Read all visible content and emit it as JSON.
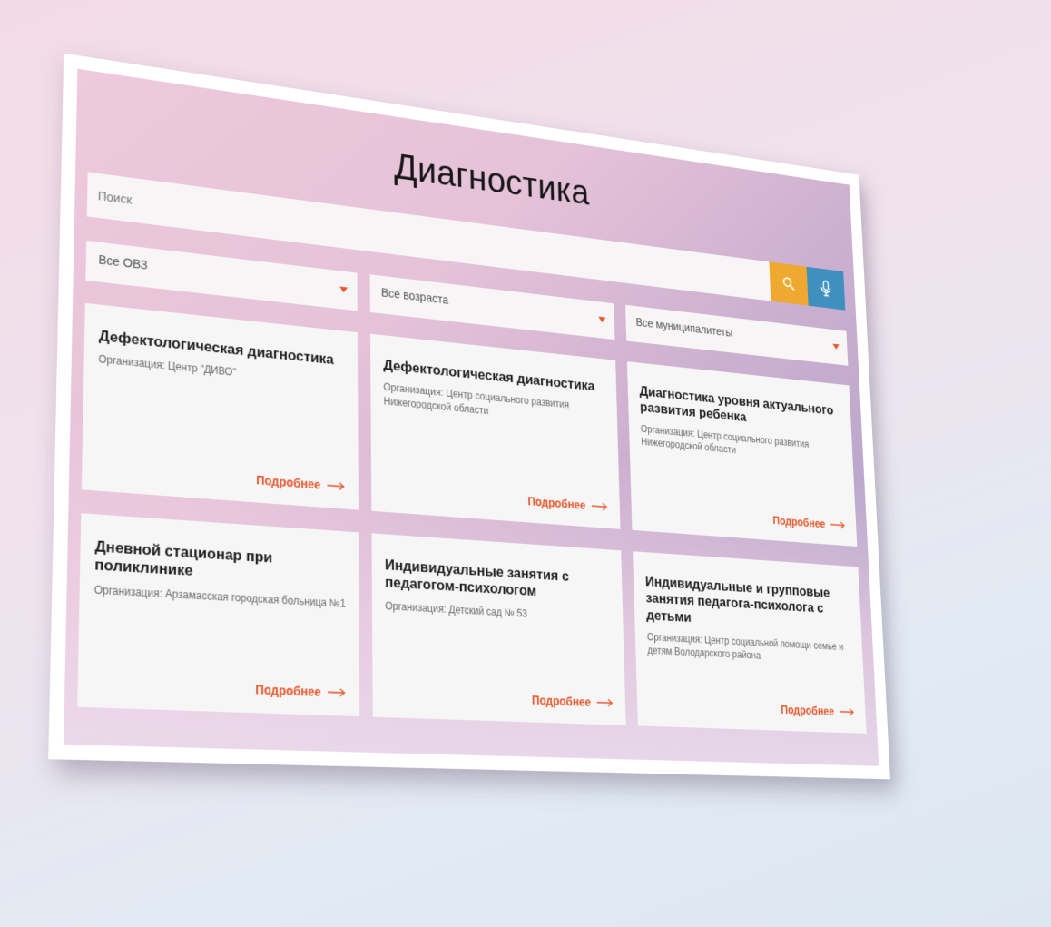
{
  "page": {
    "title": "Диагностика"
  },
  "search": {
    "placeholder": "Поиск",
    "search_icon": "search-icon",
    "mic_icon": "microphone-icon"
  },
  "filters": [
    {
      "label": "Все ОВЗ"
    },
    {
      "label": "Все возраста"
    },
    {
      "label": "Все муниципалитеты"
    }
  ],
  "cards": [
    {
      "title": "Дефектологическая диагностика",
      "org": "Организация: Центр \"ДИВО\"",
      "more": "Подробнее"
    },
    {
      "title": "Дефектологическая диагностика",
      "org": "Организация: Центр социального развития Нижегородской области",
      "more": "Подробнее"
    },
    {
      "title": "Диагностика уровня актуального развития ребенка",
      "org": "Организация: Центр социального развития Нижегородской области",
      "more": "Подробнее"
    },
    {
      "title": "Дневной стационар при поликлинике",
      "org": "Организация: Арзамасская городская больница №1",
      "more": "Подробнее"
    },
    {
      "title": "Индивидуальные занятия с педагогом-психологом",
      "org": "Организация: Детский сад № 53",
      "more": "Подробнее"
    },
    {
      "title": "Индивидуальные и групповые занятия педагога-психолога с детьми",
      "org": "Организация: Центр социальной помощи семье и детям Володарского района",
      "more": "Подробнее"
    }
  ],
  "colors": {
    "accent": "#e4582d",
    "search_button": "#f0a930",
    "mic_button": "#3f8fbf"
  }
}
